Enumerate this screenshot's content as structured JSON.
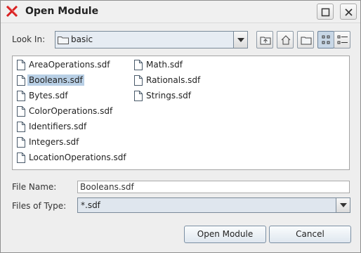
{
  "window": {
    "title": "Open Module"
  },
  "look_in": {
    "label": "Look In:",
    "value": "basic"
  },
  "files": [
    "AreaOperations.sdf",
    "Booleans.sdf",
    "Bytes.sdf",
    "ColorOperations.sdf",
    "Identifiers.sdf",
    "Integers.sdf",
    "LocationOperations.sdf",
    "Math.sdf",
    "Rationals.sdf",
    "Strings.sdf"
  ],
  "selected_file": "Booleans.sdf",
  "file_name": {
    "label": "File Name:",
    "value": "Booleans.sdf"
  },
  "files_of_type": {
    "label": "Files of Type:",
    "value": "*.sdf"
  },
  "buttons": {
    "open": "Open Module",
    "cancel": "Cancel"
  },
  "colors": {
    "app_icon": "#d92020",
    "selection": "#b8cfe5"
  }
}
